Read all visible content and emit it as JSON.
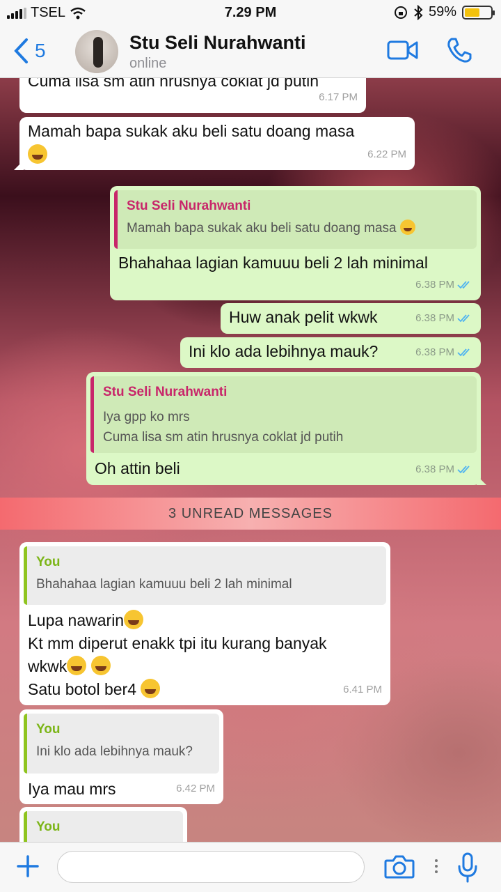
{
  "status_bar": {
    "carrier": "TSEL",
    "time": "7.29 PM",
    "battery": "59%",
    "battery_level": 0.59
  },
  "header": {
    "back_count": "5",
    "contact_name": "Stu Seli Nurahwanti",
    "contact_status": "online"
  },
  "messages": [
    {
      "dir": "in",
      "text": "Cuma lisa sm atin hrusnya coklat jd putih",
      "time": "6.17 PM"
    },
    {
      "dir": "in",
      "text": "Mamah bapa sukak aku beli satu doang masa",
      "time": "6.22 PM"
    },
    {
      "dir": "out",
      "quote_name": "Stu Seli Nurahwanti",
      "quote_text": "Mamah bapa sukak aku beli satu doang masa",
      "text": "Bhahahaa lagian kamuuu beli 2 lah minimal",
      "time": "6.38 PM"
    },
    {
      "dir": "out",
      "text": "Huw anak pelit wkwk",
      "time": "6.38 PM"
    },
    {
      "dir": "out",
      "text": "Ini klo ada lebihnya mauk?",
      "time": "6.38 PM"
    },
    {
      "dir": "out",
      "quote_name": "Stu Seli Nurahwanti",
      "quote_line1": "Iya gpp ko mrs",
      "quote_line2": "Cuma lisa sm atin hrusnya coklat jd putih",
      "text": "Oh attin beli",
      "time": "6.38 PM"
    }
  ],
  "unread_divider": "3 UNREAD MESSAGES",
  "unread": [
    {
      "dir": "in",
      "quote_name": "You",
      "quote_text": "Bhahahaa lagian kamuuu beli 2 lah minimal",
      "line1": "Lupa nawarin",
      "line2": "Kt mm diperut enakk tpi itu kurang banyak",
      "line3": "wkwk",
      "line4": "Satu botol ber4",
      "time": "6.41 PM"
    },
    {
      "dir": "in",
      "quote_name": "You",
      "quote_text": "Ini klo ada lebihnya mauk?",
      "text": "Iya mau mrs",
      "time": "6.42 PM"
    },
    {
      "dir": "in",
      "quote_name": "You"
    }
  ],
  "colors": {
    "accent": "#1f7ae0",
    "outgoing": "#dcf8c6",
    "incoming": "#ffffff",
    "quote_out_name": "#c8266a",
    "quote_in_name": "#7cb518"
  },
  "icons": [
    "back-chevron-icon",
    "video-call-icon",
    "phone-icon",
    "plus-icon",
    "camera-icon",
    "mic-icon",
    "read-receipt-icon"
  ]
}
